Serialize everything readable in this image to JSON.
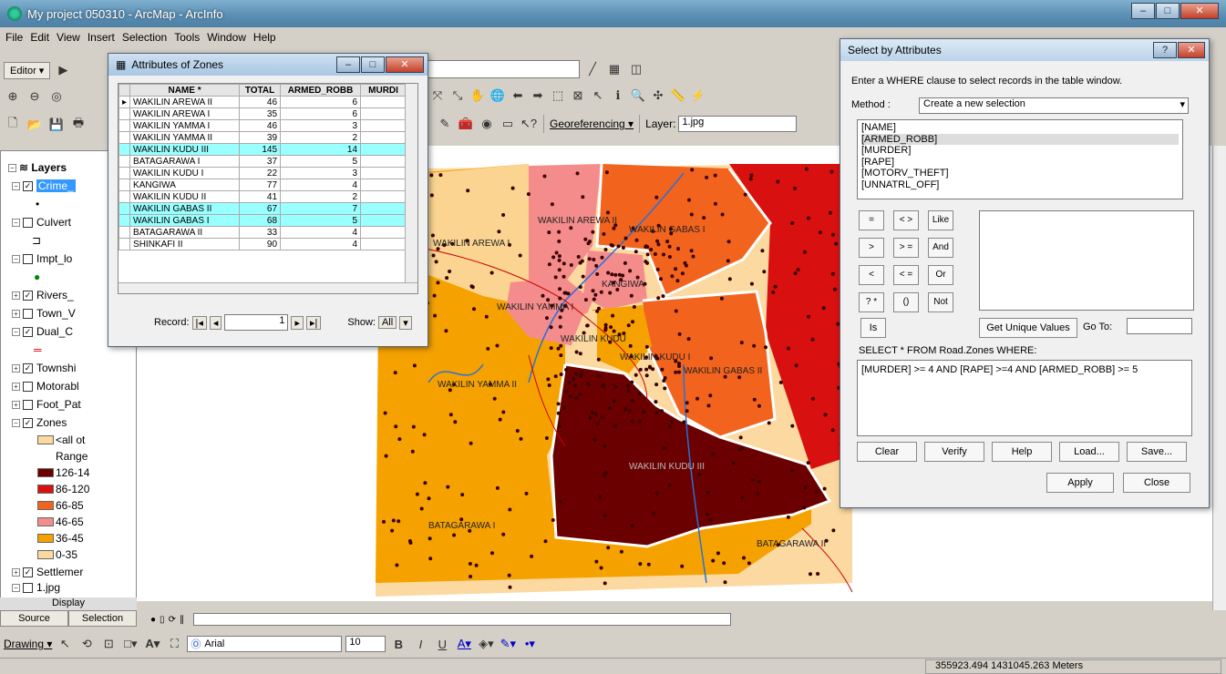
{
  "app": {
    "title": "My project 050310 - ArcMap - ArcInfo"
  },
  "menu": [
    "File",
    "Edit",
    "View",
    "Insert",
    "Selection",
    "Tools",
    "Window",
    "Help"
  ],
  "toolbar": {
    "editor": "Editor ▾",
    "georef": "Georeferencing ▾",
    "layer_label": "Layer:",
    "layer_value": "1.jpg"
  },
  "toc": {
    "items": [
      {
        "label": "Layers",
        "checked": null
      },
      {
        "label": "Crime_",
        "checked": true
      },
      {
        "label": "Culvert",
        "checked": false
      },
      {
        "label": "Impt_lo",
        "checked": false
      },
      {
        "label": "Rivers_",
        "checked": true
      },
      {
        "label": "Town_V",
        "checked": false
      },
      {
        "label": "Dual_C",
        "checked": true
      },
      {
        "label": "Townshi",
        "checked": true
      },
      {
        "label": "Motorabl",
        "checked": false
      },
      {
        "label": "Foot_Pat",
        "checked": false
      },
      {
        "label": "Zones",
        "checked": true
      }
    ],
    "legend": [
      {
        "label": "<all ot",
        "color": "#fbd9a0"
      },
      {
        "label": "Range",
        "color": null
      },
      {
        "label": "126-14",
        "color": "#6b0000"
      },
      {
        "label": "86-120",
        "color": "#d81010"
      },
      {
        "label": "66-85",
        "color": "#f2641e"
      },
      {
        "label": "46-65",
        "color": "#f48c8c"
      },
      {
        "label": "36-45",
        "color": "#f5a200"
      },
      {
        "label": "0-35",
        "color": "#fbd9a0"
      }
    ],
    "after": [
      {
        "label": "Settlemer",
        "checked": true
      },
      {
        "label": "1.jpg",
        "checked": false
      }
    ],
    "display_label": "Display",
    "tabs": [
      "Source",
      "Selection"
    ]
  },
  "attr_table": {
    "title": "Attributes of Zones",
    "columns": [
      "NAME *",
      "TOTAL",
      "ARMED_ROBB",
      "MURDI"
    ],
    "rows": [
      {
        "name": "WAKILIN AREWA II",
        "total": "46",
        "armed": "6",
        "sel": false
      },
      {
        "name": "WAKILIN AREWA I",
        "total": "35",
        "armed": "6",
        "sel": false
      },
      {
        "name": "WAKILIN YAMMA I",
        "total": "46",
        "armed": "3",
        "sel": false
      },
      {
        "name": "WAKILIN YAMMA II",
        "total": "39",
        "armed": "2",
        "sel": false
      },
      {
        "name": "WAKILIN KUDU III",
        "total": "145",
        "armed": "14",
        "sel": true
      },
      {
        "name": "BATAGARAWA I",
        "total": "37",
        "armed": "5",
        "sel": false
      },
      {
        "name": "WAKILIN KUDU I",
        "total": "22",
        "armed": "3",
        "sel": false
      },
      {
        "name": "KANGIWA",
        "total": "77",
        "armed": "4",
        "sel": false
      },
      {
        "name": "WAKILIN KUDU II",
        "total": "41",
        "armed": "2",
        "sel": false
      },
      {
        "name": "WAKILIN GABAS II",
        "total": "67",
        "armed": "7",
        "sel": true
      },
      {
        "name": "WAKILIN GABAS I",
        "total": "68",
        "armed": "5",
        "sel": true
      },
      {
        "name": "BATAGARAWA II",
        "total": "33",
        "armed": "4",
        "sel": false
      },
      {
        "name": "SHINKAFI II",
        "total": "90",
        "armed": "4",
        "sel": false
      }
    ],
    "record_label": "Record:",
    "record_value": "1",
    "show_label": "Show:",
    "show_value": "All"
  },
  "sba": {
    "title": "Select by Attributes",
    "instruction": "Enter a WHERE clause to select records in the table window.",
    "method_label": "Method :",
    "method_value": "Create a new selection",
    "fields": [
      "[NAME]",
      "[ARMED_ROBB]",
      "[MURDER]",
      "[RAPE]",
      "[MOTORV_THEFT]",
      "[UNNATRL_OFF]"
    ],
    "ops": [
      "=",
      "< >",
      "Like",
      ">",
      "> =",
      "And",
      "<",
      "< =",
      "Or",
      "? *",
      "()",
      "Not"
    ],
    "is": "Is",
    "unique_values": "Get Unique Values",
    "goto": "Go To:",
    "select_from": "SELECT * FROM Road.Zones WHERE:",
    "expression": "[MURDER] >= 4 AND [RAPE] >=4 AND [ARMED_ROBB] >= 5",
    "buttons": [
      "Clear",
      "Verify",
      "Help",
      "Load...",
      "Save..."
    ],
    "apply": "Apply",
    "close": "Close"
  },
  "map_labels": [
    "WAKILIN AREWA II",
    "WAKILIN GABAS I",
    "WAKILIN AREWA I",
    "WAKILIN YAMMA I",
    "KANGIWA",
    "WAKILIN KUDU I",
    "WAKILIN KUDU",
    "WAKILIN GABAS II",
    "WAKILIN YAMMA II",
    "WAKILIN KUDU III",
    "BATAGARAWA I",
    "BATAGARAWA II"
  ],
  "drawing": {
    "label": "Drawing ▾",
    "font": "Arial",
    "size": "10"
  },
  "status": {
    "coords": "355923.494  1431045.263 Meters"
  },
  "colors": {
    "dark": "#6b0000",
    "red": "#d81010",
    "orange": "#f2641e",
    "pink": "#f48c8c",
    "amber": "#f5a200",
    "tan": "#fbd9a0"
  }
}
